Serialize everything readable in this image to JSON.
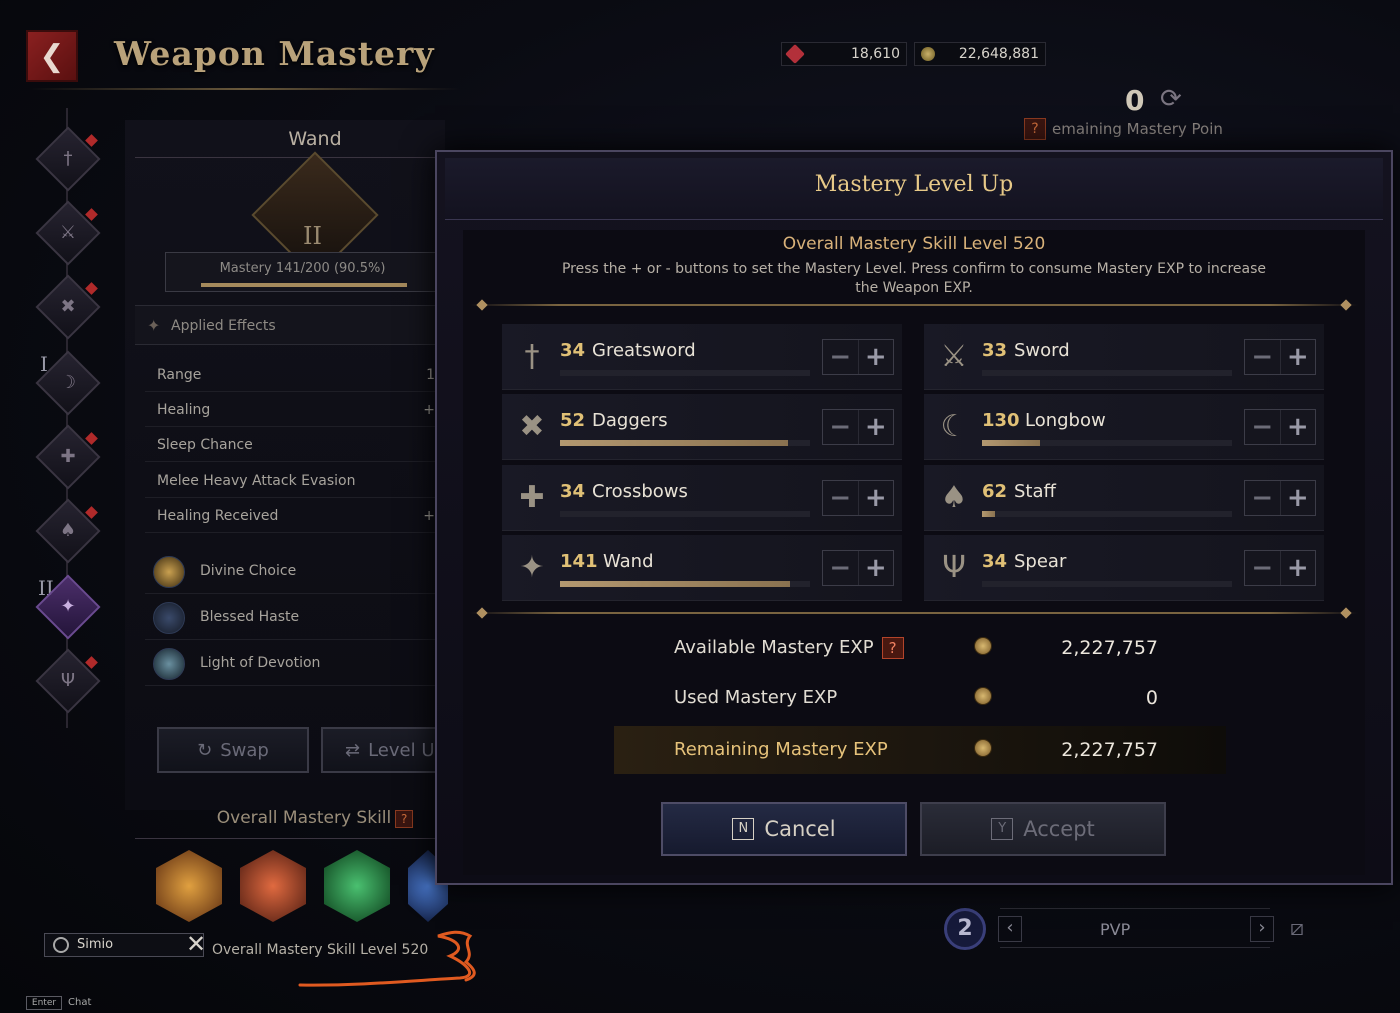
{
  "header": {
    "title": "Weapon Mastery",
    "back_icon": "back-arrow-icon"
  },
  "currency": {
    "gems": "18,610",
    "gold": "22,648,881"
  },
  "mastery_points": {
    "value": "0",
    "label": "emaining Mastery Poin",
    "help": "?"
  },
  "left": {
    "weapon": "Wand",
    "emblem_rank": "II",
    "mastery_text": "Mastery 141/200 (90.5%)",
    "mastery_fraction": 0.905,
    "applied_effects": "Applied Effects",
    "effects": [
      {
        "name": "Range",
        "value": "1"
      },
      {
        "name": "Healing",
        "value": "+"
      },
      {
        "name": "Sleep Chance",
        "value": ""
      },
      {
        "name": "Melee Heavy Attack Evasion",
        "value": ""
      },
      {
        "name": "Healing Received",
        "value": "+"
      }
    ],
    "skills": [
      "Divine Choice",
      "Blessed Haste",
      "Light of Devotion"
    ],
    "swap_label": "Swap",
    "levelup_label": "Level U",
    "oms_title": "Overall Mastery Skill",
    "oms_help": "?",
    "rail_marks": [
      "I",
      "II"
    ]
  },
  "chat": {
    "user": "Simio",
    "oms_level_text": "Overall Mastery Skill Level 520",
    "enter_key": "Enter",
    "chat_label": "Chat"
  },
  "pvp": {
    "badge": "2",
    "label": "PVP"
  },
  "modal": {
    "title": "Mastery Level Up",
    "oms_heading": "Overall Mastery Skill Level 520",
    "description": "Press the + or - buttons to set the Mastery Level. Press confirm to consume Mastery EXP to increase the Weapon EXP.",
    "weapons": [
      {
        "level": "34",
        "name": "Greatsword",
        "progress": 0.0,
        "icon": "greatsword-icon"
      },
      {
        "level": "33",
        "name": "Sword",
        "progress": 0.0,
        "icon": "sword-icon"
      },
      {
        "level": "52",
        "name": "Daggers",
        "progress": 0.91,
        "icon": "daggers-icon"
      },
      {
        "level": "130",
        "name": "Longbow",
        "progress": 0.23,
        "icon": "longbow-icon"
      },
      {
        "level": "34",
        "name": "Crossbows",
        "progress": 0.0,
        "icon": "crossbow-icon"
      },
      {
        "level": "62",
        "name": "Staff",
        "progress": 0.05,
        "icon": "staff-icon"
      },
      {
        "level": "141",
        "name": "Wand",
        "progress": 0.92,
        "icon": "wand-icon"
      },
      {
        "level": "34",
        "name": "Spear",
        "progress": 0.0,
        "icon": "spear-icon"
      }
    ],
    "exp": {
      "available_label": "Available Mastery EXP",
      "available_help": "?",
      "available": "2,227,757",
      "used_label": "Used Mastery EXP",
      "used": "0",
      "remaining_label": "Remaining Mastery EXP",
      "remaining": "2,227,757"
    },
    "cancel": {
      "key": "N",
      "label": "Cancel"
    },
    "accept": {
      "key": "Y",
      "label": "Accept"
    }
  }
}
